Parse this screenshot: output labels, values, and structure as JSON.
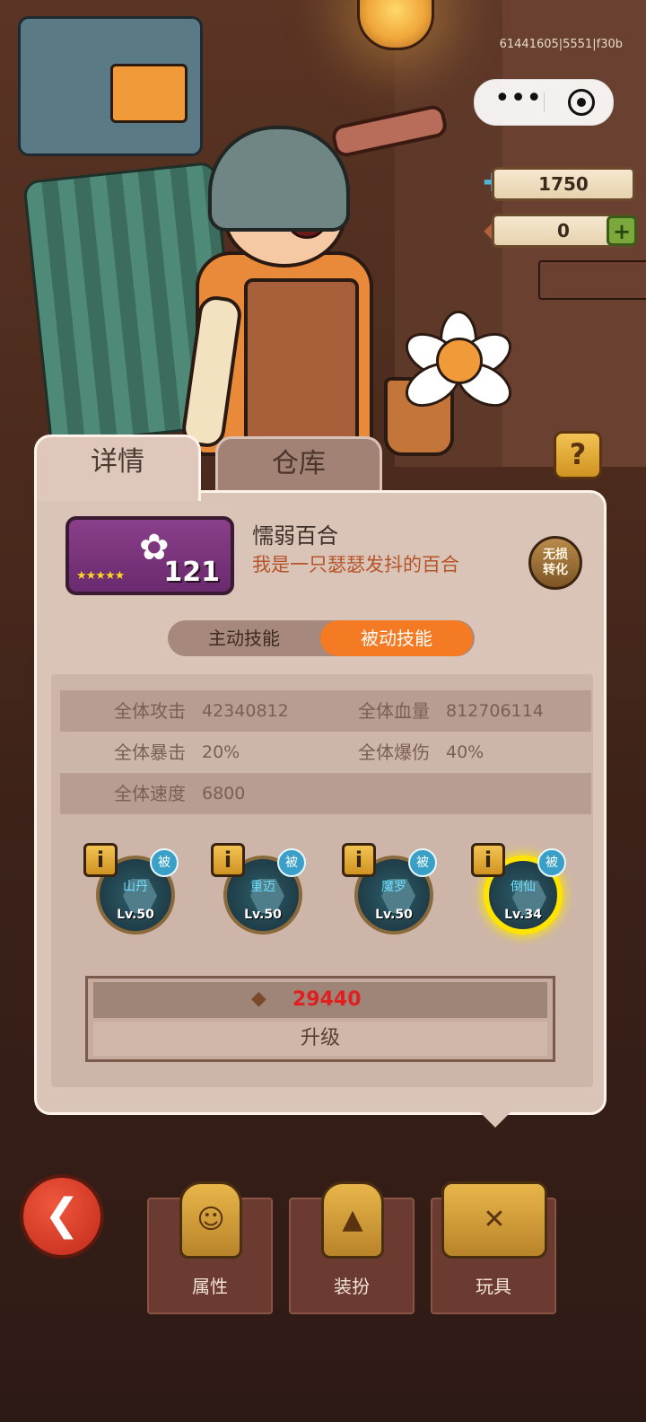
{
  "status": {
    "device_id": "61441605|5551|f30b"
  },
  "resources": [
    {
      "icon": "puzzle-icon",
      "value": "1750"
    },
    {
      "icon": "gem-icon",
      "value": "0",
      "has_plus": true
    }
  ],
  "tabs": [
    {
      "label": "详情",
      "active": true
    },
    {
      "label": "仓库",
      "active": false
    }
  ],
  "help_label": "?",
  "toy": {
    "name": "懦弱百合",
    "description": "我是一只瑟瑟发抖的百合",
    "level": "121",
    "stars": 5,
    "convert_label_1": "无损",
    "convert_label_2": "转化"
  },
  "skill_tabs": {
    "active": "主动技能",
    "passive": "被动技能"
  },
  "stats": [
    {
      "label": "全体攻击",
      "value": "42340812",
      "label2": "全体血量",
      "value2": "812706114"
    },
    {
      "label": "全体暴击",
      "value": "20%",
      "label2": "全体爆伤",
      "value2": "40%"
    },
    {
      "label": "全体速度",
      "value": "6800",
      "label2": "",
      "value2": ""
    }
  ],
  "skills": [
    {
      "name": "山丹",
      "level": "Lv.50",
      "badge": "被",
      "info": "i",
      "selected": false
    },
    {
      "name": "重迈",
      "level": "Lv.50",
      "badge": "被",
      "info": "i",
      "selected": false
    },
    {
      "name": "魔罗",
      "level": "Lv.50",
      "badge": "被",
      "info": "i",
      "selected": false
    },
    {
      "name": "倒仙",
      "level": "Lv.34",
      "badge": "被",
      "info": "i",
      "selected": true
    }
  ],
  "upgrade": {
    "cost": "29440",
    "label": "升级"
  },
  "nav": [
    {
      "label": "属性",
      "icon": "character-icon"
    },
    {
      "label": "装扮",
      "icon": "outfit-icon"
    },
    {
      "label": "玩具",
      "icon": "toybox-icon"
    }
  ],
  "colors": {
    "accent": "#f47a23",
    "cost": "#e02020",
    "selected_ring": "#ffe400"
  }
}
